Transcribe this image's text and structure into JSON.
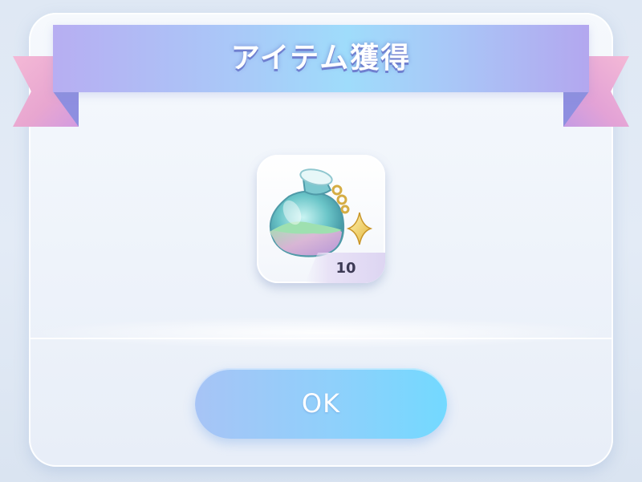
{
  "dialog": {
    "title": "アイテム獲得"
  },
  "reward": {
    "icon": "glass-bottle-star-charm-icon",
    "count": "10"
  },
  "actions": {
    "ok_label": "OK"
  },
  "colors": {
    "ribbon_gradient": [
      "#b7aef2",
      "#9fdcfb",
      "#b3a7ef"
    ],
    "ribbon_tail": "#f4b9d6",
    "button_gradient": [
      "#a7c4f6",
      "#73d9ff"
    ],
    "dialog_bg": "#f3f7fc",
    "count_text": "#3d3a55"
  }
}
